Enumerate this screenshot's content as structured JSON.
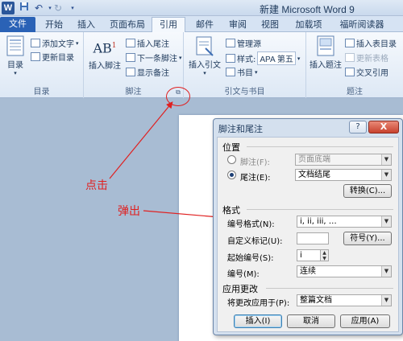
{
  "window": {
    "title": "新建 Microsoft Word 9"
  },
  "quick_access": {
    "word_logo": "W",
    "save_icon": "save-icon",
    "undo_icon": "undo-icon",
    "redo_icon": "redo-icon"
  },
  "tabs": [
    {
      "label": "文件"
    },
    {
      "label": "开始"
    },
    {
      "label": "插入"
    },
    {
      "label": "页面布局"
    },
    {
      "label": "引用"
    },
    {
      "label": "邮件"
    },
    {
      "label": "审阅"
    },
    {
      "label": "视图"
    },
    {
      "label": "加载项"
    },
    {
      "label": "福昕阅读器"
    }
  ],
  "active_tab": "引用",
  "ribbon": {
    "toc_group": {
      "label": "目录",
      "toc_button": "目录",
      "add_text": "添加文字",
      "update_toc": "更新目录"
    },
    "footnote_group": {
      "label": "脚注",
      "insert_footnote": "插入脚注",
      "ab_icon_text": "AB",
      "ab_sup": "1",
      "insert_endnote": "插入尾注",
      "next_footnote": "下一条脚注",
      "show_notes": "显示备注"
    },
    "citation_group": {
      "label": "引文与书目",
      "insert_citation": "插入引文",
      "manage_sources": "管理源",
      "style_label": "样式:",
      "style_value": "APA 第五",
      "bibliography": "书目"
    },
    "caption_group": {
      "label": "题注",
      "insert_caption": "插入题注",
      "insert_table_of_figures": "插入表目录",
      "update_table": "更新表格",
      "cross_reference": "交叉引用"
    }
  },
  "annotations": {
    "click_label": "点击",
    "popup_label": "弹出"
  },
  "dialog": {
    "title": "脚注和尾注",
    "help": "?",
    "close": "X",
    "location_section": "位置",
    "footnote_label": "脚注(F):",
    "footnote_value": "页面底端",
    "endnote_label": "尾注(E):",
    "endnote_value": "文档结尾",
    "convert_button": "转换(C)...",
    "format_section": "格式",
    "number_format_label": "编号格式(N):",
    "number_format_value": "i, ii, iii, …",
    "custom_mark_label": "自定义标记(U):",
    "custom_mark_value": "",
    "symbol_button": "符号(Y)...",
    "start_at_label": "起始编号(S):",
    "start_at_value": "i",
    "numbering_label": "编号(M):",
    "numbering_value": "连续",
    "apply_section": "应用更改",
    "apply_to_label": "将更改应用于(P):",
    "apply_to_value": "整篇文档",
    "insert_button": "插入(I)",
    "cancel_button": "取消",
    "apply_button": "应用(A)"
  }
}
